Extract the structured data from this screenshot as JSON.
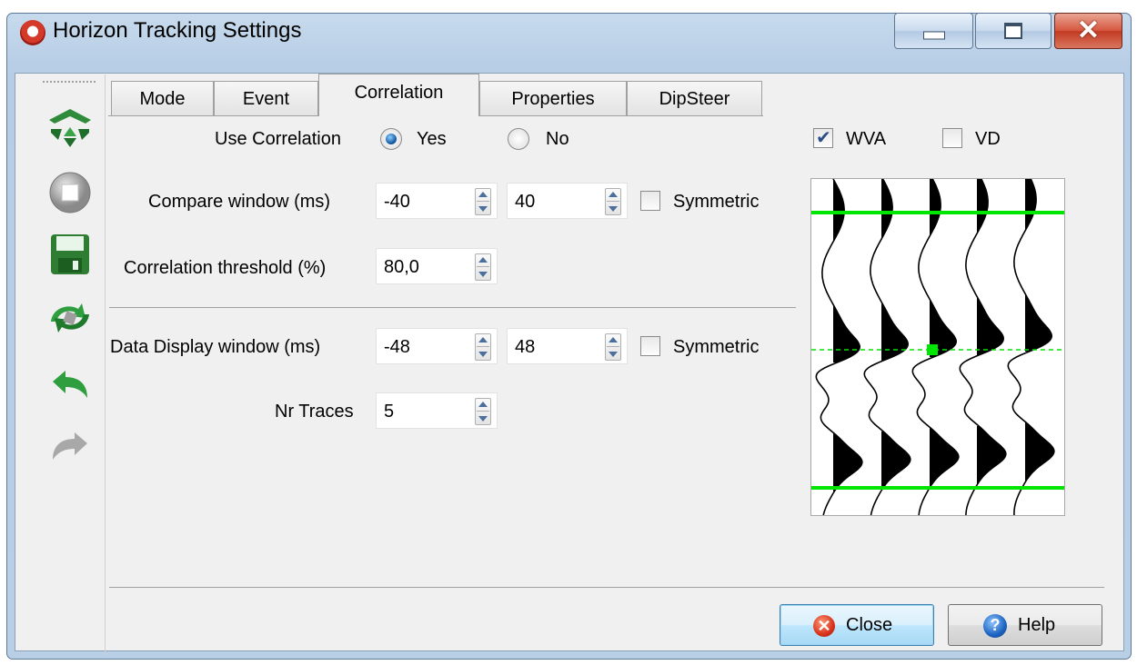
{
  "window": {
    "title": "Horizon Tracking Settings"
  },
  "tabs": [
    {
      "label": "Mode"
    },
    {
      "label": "Event"
    },
    {
      "label": "Correlation",
      "active": true
    },
    {
      "label": "Properties"
    },
    {
      "label": "DipSteer"
    }
  ],
  "correlation": {
    "use_label": "Use Correlation",
    "yes_label": "Yes",
    "no_label": "No",
    "use_value": "Yes",
    "compare_label": "Compare window (ms)",
    "compare_start": "-40",
    "compare_stop": "40",
    "compare_symmetric_label": "Symmetric",
    "compare_symmetric": false,
    "threshold_label": "Correlation threshold (%)",
    "threshold": "80,0",
    "display_label": "Data Display window (ms)",
    "display_start": "-48",
    "display_stop": "48",
    "display_symmetric_label": "Symmetric",
    "display_symmetric": false,
    "nrtraces_label": "Nr Traces",
    "nrtraces": "5"
  },
  "display_options": {
    "wva_label": "WVA",
    "wva": true,
    "vd_label": "VD",
    "vd": false
  },
  "preview": {
    "traces": 5,
    "colors": {
      "trace": "#000000",
      "horizon": "#00e600",
      "background": "#ffffff"
    }
  },
  "buttons": {
    "close_label": "Close",
    "help_label": "Help"
  },
  "icons": {
    "toolbar": [
      "tracking-settings-icon",
      "stop-icon",
      "save-icon",
      "retrack-icon",
      "undo-icon",
      "redo-icon"
    ],
    "close": "close-circle-icon",
    "help": "help-circle-icon"
  },
  "colors": {
    "accent": "#1a5fa8",
    "titlebar": "#b9cfe6",
    "close_button": "#c23a22"
  }
}
